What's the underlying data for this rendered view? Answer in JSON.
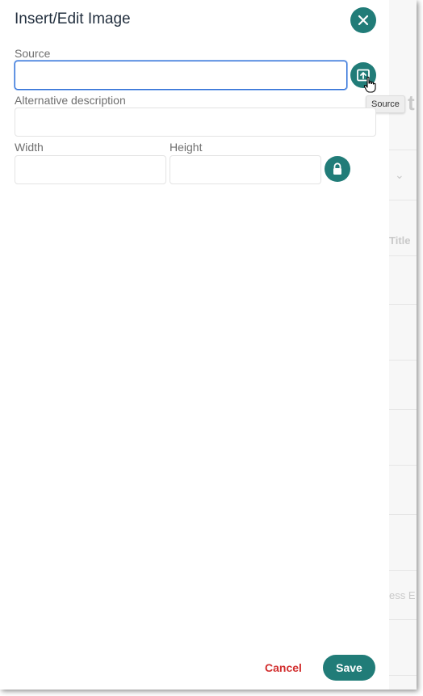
{
  "dialog": {
    "title": "Insert/Edit Image",
    "close_icon": "close-icon"
  },
  "form": {
    "source": {
      "label": "Source",
      "value": "",
      "browse_icon": "upload-icon"
    },
    "alt": {
      "label": "Alternative description",
      "value": ""
    },
    "width": {
      "label": "Width",
      "value": ""
    },
    "height": {
      "label": "Height",
      "value": ""
    },
    "lock_icon": "lock-icon"
  },
  "tooltip": {
    "text": "Source"
  },
  "footer": {
    "cancel_label": "Cancel",
    "save_label": "Save"
  },
  "background": {
    "fragment_title": "Title",
    "fragment_es": "ess E",
    "fragment_t": "t"
  },
  "colors": {
    "accent": "#217c78",
    "danger": "#d22f2f",
    "focus": "#2f6fd6",
    "title_text": "#222f3e"
  }
}
